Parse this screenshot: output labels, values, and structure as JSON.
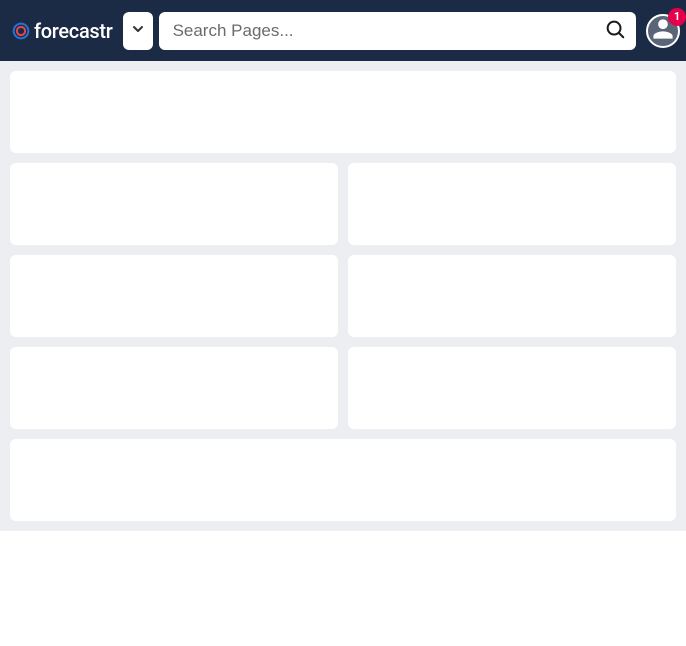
{
  "header": {
    "brand": "forecastr",
    "search_placeholder": "Search Pages...",
    "notification_count": "1"
  }
}
